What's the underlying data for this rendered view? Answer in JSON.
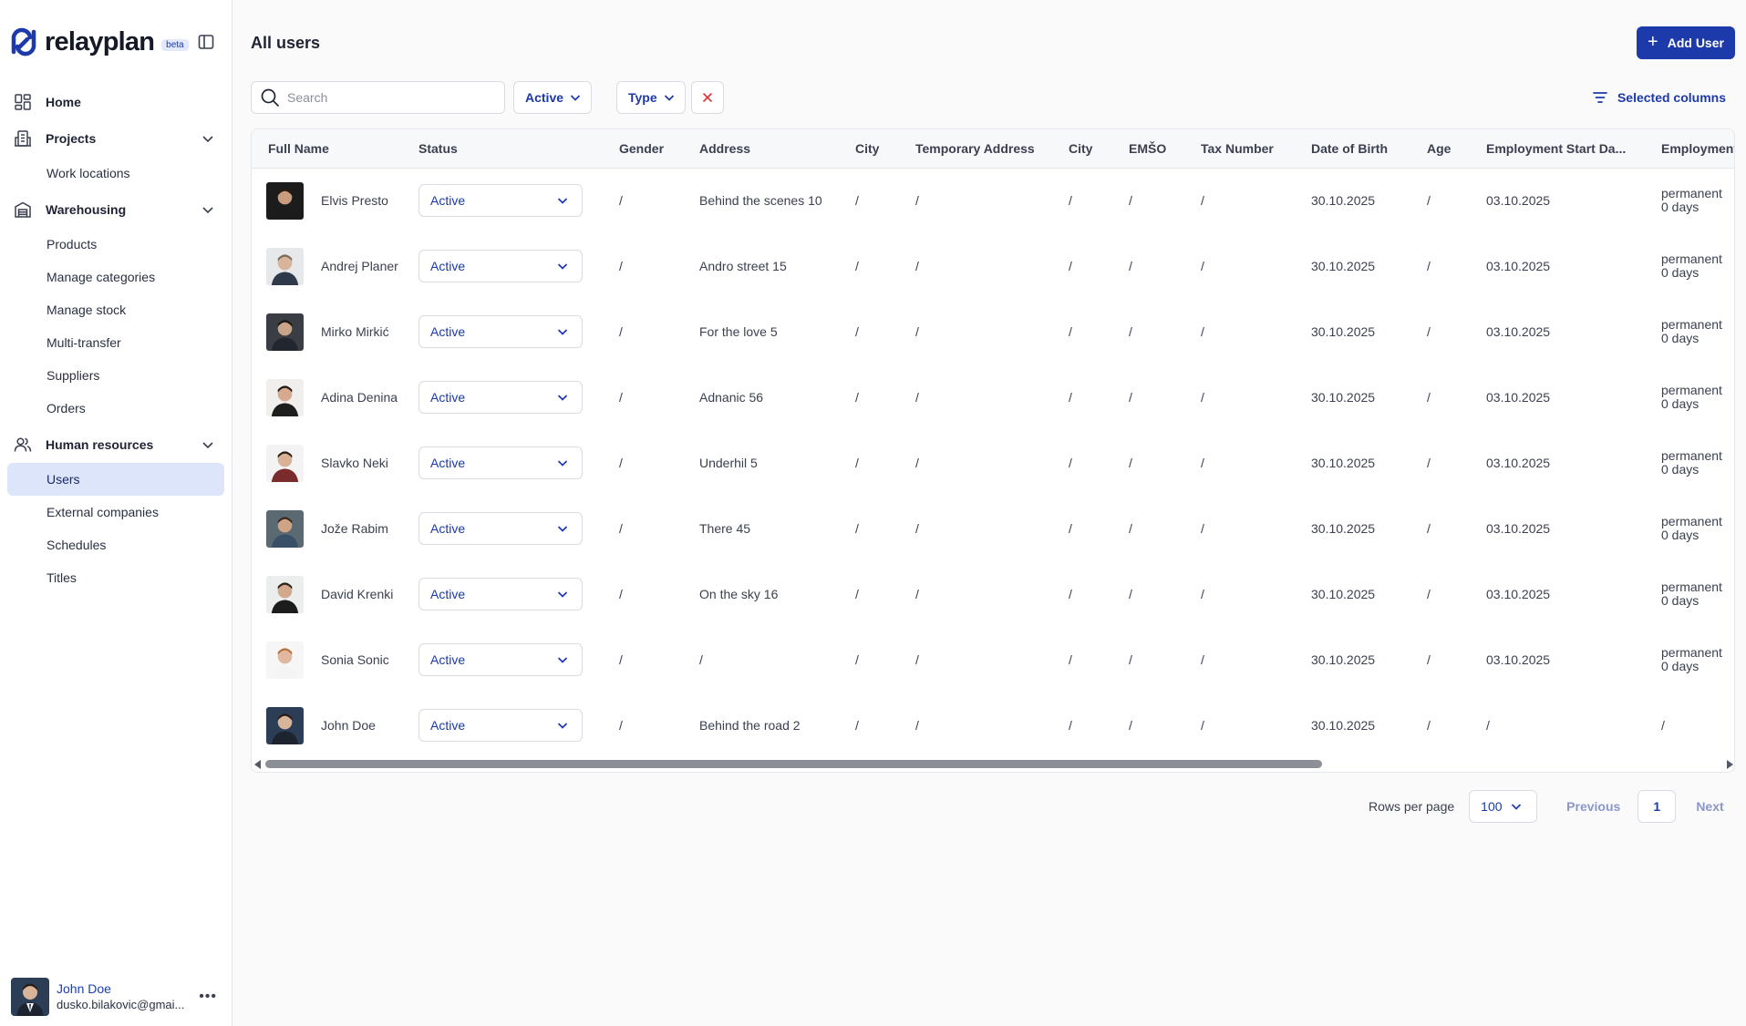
{
  "app": {
    "name": "relayplan",
    "badge": "beta"
  },
  "sidebar": {
    "home": "Home",
    "projects": {
      "label": "Projects",
      "items": [
        "Work locations"
      ]
    },
    "warehousing": {
      "label": "Warehousing",
      "items": [
        "Products",
        "Manage categories",
        "Manage stock",
        "Multi-transfer",
        "Suppliers",
        "Orders"
      ]
    },
    "hr": {
      "label": "Human resources",
      "items": [
        "Users",
        "External companies",
        "Schedules",
        "Titles"
      ],
      "active": "Users"
    }
  },
  "current_user": {
    "name": "John Doe",
    "email": "dusko.bilakovic@gmai..."
  },
  "page": {
    "title": "All users",
    "add_label": "Add User"
  },
  "toolbar": {
    "search_placeholder": "Search",
    "filter_status": "Active",
    "filter_type": "Type",
    "columns_label": "Selected columns"
  },
  "table": {
    "columns": [
      "Full Name",
      "Status",
      "Gender",
      "Address",
      "City",
      "Temporary Address",
      "City",
      "EMŠO",
      "Tax Number",
      "Date of Birth",
      "Age",
      "Employment Start Da...",
      "Employment"
    ],
    "rows": [
      {
        "name": "Elvis Presto",
        "status": "Active",
        "gender": "/",
        "address": "Behind the scenes 10",
        "city": "/",
        "temp_address": "/",
        "temp_city": "/",
        "emso": "/",
        "tax": "/",
        "dob": "30.10.2025",
        "age": "/",
        "start": "03.10.2025",
        "emp_type": "permanent",
        "emp_days": "0 days"
      },
      {
        "name": "Andrej Planer",
        "status": "Active",
        "gender": "/",
        "address": "Andro street 15",
        "city": "/",
        "temp_address": "/",
        "temp_city": "/",
        "emso": "/",
        "tax": "/",
        "dob": "30.10.2025",
        "age": "/",
        "start": "03.10.2025",
        "emp_type": "permanent",
        "emp_days": "0 days"
      },
      {
        "name": "Mirko Mirkić",
        "status": "Active",
        "gender": "/",
        "address": "For the love 5",
        "city": "/",
        "temp_address": "/",
        "temp_city": "/",
        "emso": "/",
        "tax": "/",
        "dob": "30.10.2025",
        "age": "/",
        "start": "03.10.2025",
        "emp_type": "permanent",
        "emp_days": "0 days"
      },
      {
        "name": "Adina Denina",
        "status": "Active",
        "gender": "/",
        "address": "Adnanic 56",
        "city": "/",
        "temp_address": "/",
        "temp_city": "/",
        "emso": "/",
        "tax": "/",
        "dob": "30.10.2025",
        "age": "/",
        "start": "03.10.2025",
        "emp_type": "permanent",
        "emp_days": "0 days"
      },
      {
        "name": "Slavko Neki",
        "status": "Active",
        "gender": "/",
        "address": "Underhil 5",
        "city": "/",
        "temp_address": "/",
        "temp_city": "/",
        "emso": "/",
        "tax": "/",
        "dob": "30.10.2025",
        "age": "/",
        "start": "03.10.2025",
        "emp_type": "permanent",
        "emp_days": "0 days"
      },
      {
        "name": "Jože Rabim",
        "status": "Active",
        "gender": "/",
        "address": "There 45",
        "city": "/",
        "temp_address": "/",
        "temp_city": "/",
        "emso": "/",
        "tax": "/",
        "dob": "30.10.2025",
        "age": "/",
        "start": "03.10.2025",
        "emp_type": "permanent",
        "emp_days": "0 days"
      },
      {
        "name": "David Krenki",
        "status": "Active",
        "gender": "/",
        "address": "On the sky 16",
        "city": "/",
        "temp_address": "/",
        "temp_city": "/",
        "emso": "/",
        "tax": "/",
        "dob": "30.10.2025",
        "age": "/",
        "start": "03.10.2025",
        "emp_type": "permanent",
        "emp_days": "0 days"
      },
      {
        "name": "Sonia Sonic",
        "status": "Active",
        "gender": "/",
        "address": "/",
        "city": "/",
        "temp_address": "/",
        "temp_city": "/",
        "emso": "/",
        "tax": "/",
        "dob": "30.10.2025",
        "age": "/",
        "start": "03.10.2025",
        "emp_type": "permanent",
        "emp_days": "0 days"
      },
      {
        "name": "John Doe",
        "status": "Active",
        "gender": "/",
        "address": "Behind the road 2",
        "city": "/",
        "temp_address": "/",
        "temp_city": "/",
        "emso": "/",
        "tax": "/",
        "dob": "30.10.2025",
        "age": "/",
        "start": "/",
        "emp_type": "/",
        "emp_days": ""
      }
    ]
  },
  "pagination": {
    "rows_label": "Rows per page",
    "rows_value": "100",
    "previous": "Previous",
    "current_page": "1",
    "next": "Next"
  },
  "colors": {
    "accent": "#1c3aa9",
    "active_nav": "#dde5fb",
    "clear_x": "#d93a3a"
  }
}
